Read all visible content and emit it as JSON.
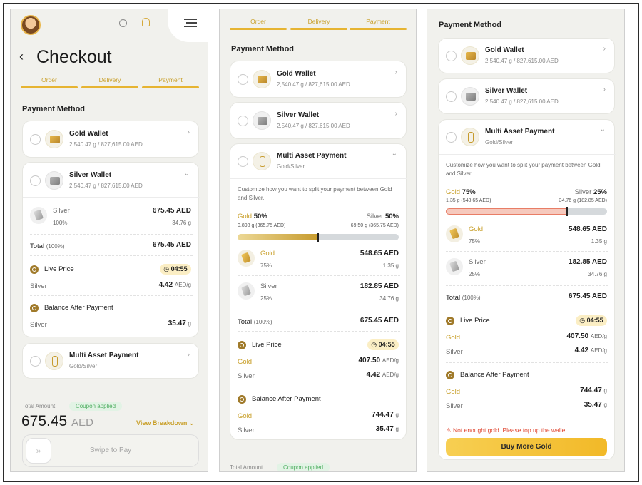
{
  "tabs": [
    "Order",
    "Delivery",
    "Payment"
  ],
  "screen1": {
    "title": "Checkout",
    "section": "Payment Method",
    "gold_wallet": {
      "name": "Gold Wallet",
      "balance": "2,540.47 g / 827,615.00 AED"
    },
    "silver_wallet": {
      "name": "Silver Wallet",
      "balance": "2,540.47 g / 827,615.00 AED"
    },
    "silver_row": {
      "metal": "Silver",
      "pct": "100%",
      "amount": "675.45 AED",
      "grams": "34.76 g"
    },
    "total": {
      "label": "Total",
      "pct": "(100%)",
      "value": "675.45 AED"
    },
    "live_price": {
      "label": "Live Price",
      "timer": "04:55",
      "metal": "Silver",
      "value": "4.42",
      "unit": "AED/g"
    },
    "balance_after": {
      "label": "Balance After Payment",
      "metal": "Silver",
      "value": "35.47",
      "unit": "g"
    },
    "multi": {
      "name": "Multi Asset Payment",
      "sub": "Gold/Silver"
    },
    "total_amount_label": "Total Amount",
    "coupon": "Coupon applied",
    "amount": "675.45",
    "currency": "AED",
    "view_breakdown": "View Breakdown",
    "swipe": "Swipe to Pay"
  },
  "screen2": {
    "section": "Payment Method",
    "gold_wallet": {
      "name": "Gold Wallet",
      "balance": "2,540.47 g / 827,615.00 AED"
    },
    "silver_wallet": {
      "name": "Silver Wallet",
      "balance": "2,540.47 g / 827,615.00 AED"
    },
    "multi": {
      "name": "Multi Asset Payment",
      "sub": "Gold/Silver"
    },
    "desc": "Customize how you want to split your payment between Gold and Silver.",
    "gold_label": "Gold",
    "gold_pct": "50%",
    "gold_detail": "0.898 g (365.75 AED)",
    "silver_label": "Silver",
    "silver_pct": "50%",
    "silver_detail": "69.50 g (365.75 AED)",
    "split_fraction": 0.5,
    "rows": [
      {
        "metal": "Gold",
        "pct": "75%",
        "amount": "548.65 AED",
        "grams": "1.35 g"
      },
      {
        "metal": "Silver",
        "pct": "25%",
        "amount": "182.85 AED",
        "grams": "34.76 g"
      }
    ],
    "total": {
      "label": "Total",
      "pct": "(100%)",
      "value": "675.45 AED"
    },
    "live_price": {
      "label": "Live Price",
      "timer": "04:55",
      "gold": "407.50",
      "silver": "4.42",
      "unit": "AED/g"
    },
    "balance_after": {
      "label": "Balance After Payment",
      "gold": "744.47",
      "silver": "35.47",
      "unit": "g"
    },
    "total_amount_label": "Total Amount",
    "coupon": "Coupon applied"
  },
  "screen3": {
    "section": "Payment Method",
    "gold_wallet": {
      "name": "Gold Wallet",
      "balance": "2,540.47 g / 827,615.00 AED"
    },
    "silver_wallet": {
      "name": "Silver Wallet",
      "balance": "2,540.47 g / 827,615.00 AED"
    },
    "multi": {
      "name": "Multi Asset Payment",
      "sub": "Gold/Silver"
    },
    "desc": "Customize how you want to split your payment between Gold and Silver.",
    "gold_label": "Gold",
    "gold_pct": "75%",
    "gold_detail": "1.35 g (548.65 AED)",
    "silver_label": "Silver",
    "silver_pct": "25%",
    "silver_detail": "34.76 g (182.85 AED)",
    "split_fraction": 0.75,
    "rows": [
      {
        "metal": "Gold",
        "pct": "75%",
        "amount": "548.65 AED",
        "grams": "1.35 g"
      },
      {
        "metal": "Silver",
        "pct": "25%",
        "amount": "182.85 AED",
        "grams": "34.76 g"
      }
    ],
    "total": {
      "label": "Total",
      "pct": "(100%)",
      "value": "675.45 AED"
    },
    "live_price": {
      "label": "Live Price",
      "timer": "04:55",
      "gold": "407.50",
      "silver": "4.42",
      "unit": "AED/g"
    },
    "balance_after": {
      "label": "Balance After Payment",
      "gold": "744.47",
      "silver": "35.47",
      "unit": "g"
    },
    "warning": "Not enought gold. Please top up the wallet",
    "buy_button": "Buy More Gold"
  },
  "colors": {
    "accent": "#e6b432",
    "gold_text": "#c9a02b",
    "warning": "#e0452f",
    "coupon": "#4fae61"
  }
}
